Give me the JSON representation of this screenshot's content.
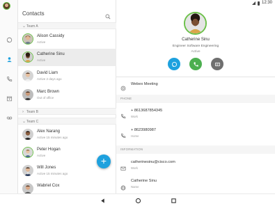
{
  "status_bar": {
    "time": "12:30"
  },
  "contacts": {
    "title": "Contacts",
    "groups": [
      {
        "label": "Team A",
        "expanded": true
      },
      {
        "label": "Team B",
        "expanded": false
      },
      {
        "label": "Team C",
        "expanded": true
      }
    ],
    "team_a": [
      {
        "name": "Alison Cassidy",
        "status": "Active"
      },
      {
        "name": "Catherine Sinu",
        "status": "Active"
      },
      {
        "name": "David Liam",
        "status": "Active 2 days ago"
      },
      {
        "name": "Marc Brown",
        "status": "Out of office"
      }
    ],
    "team_c": [
      {
        "name": "Alex Narang",
        "status": "Active 15 minutes ago"
      },
      {
        "name": "Peter Hogan",
        "status": "Active"
      },
      {
        "name": "Will Jones",
        "status": "Active 15 minutes ago"
      },
      {
        "name": "Wabriel Cox",
        "status": ""
      }
    ],
    "fab_label": "+"
  },
  "detail": {
    "name": "Catherine Sinu",
    "title": "Engineer Software Engineering",
    "status": "Active",
    "webex": "Webex Meeting",
    "phone_section": "PHONE",
    "phones": [
      {
        "number": "+ 8613687854345",
        "type": "Work"
      },
      {
        "number": "+ 8623980987",
        "type": "Home"
      }
    ],
    "info_section": "INFORMATION",
    "email": {
      "value": "catherinesinu@cisco.com",
      "type": "Work"
    },
    "display_name": {
      "value": "Catherine Sinu",
      "type": "Name"
    }
  },
  "colors": {
    "accent": "#1ea1de",
    "presence": "#6cc04a",
    "call": "#4caf50",
    "more": "#6f6f6f"
  }
}
